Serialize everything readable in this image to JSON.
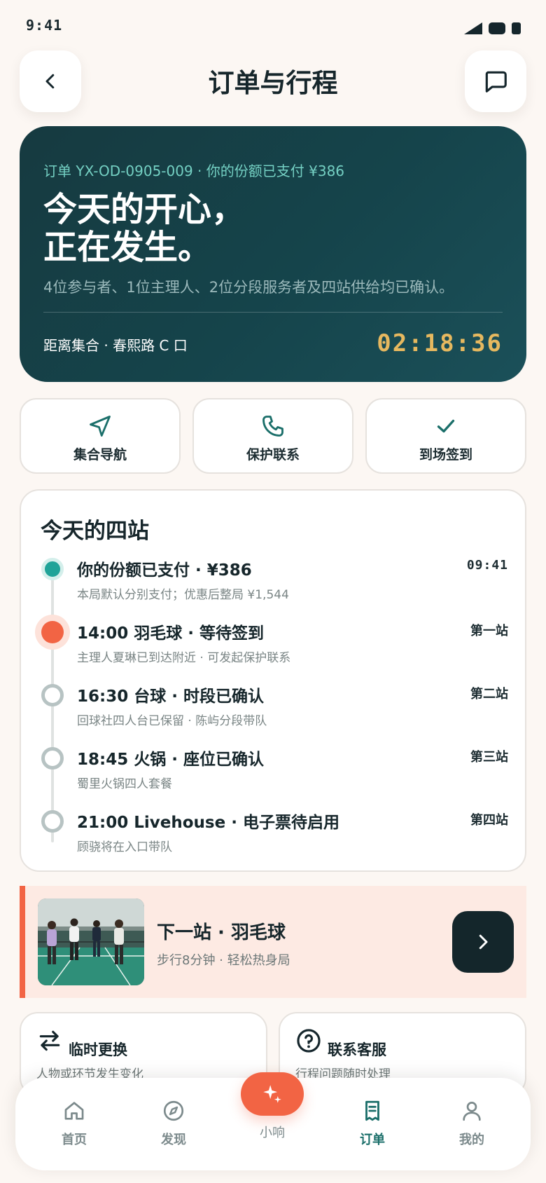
{
  "status_bar": {
    "time": "9:41"
  },
  "header": {
    "title": "订单与行程",
    "back_icon": "chevron-left-icon",
    "message_icon": "chat-icon"
  },
  "hero": {
    "order_line": "订单 YX-OD-0905-009 · 你的份额已支付 ¥386",
    "headline_1": "今天的开心，",
    "headline_2": "正在发生。",
    "subtitle": "4位参与者、1位主理人、2位分段服务者及四站供给均已确认。",
    "distance_label": "距离集合 · 春熙路 C 口",
    "countdown": "02:18:36",
    "countdown_color": "#e6b85f"
  },
  "actions": [
    {
      "label": "集合导航",
      "icon": "navigation-icon"
    },
    {
      "label": "保护联系",
      "icon": "phone-icon"
    },
    {
      "label": "到场签到",
      "icon": "check-icon"
    }
  ],
  "stations": {
    "title": "今天的四站",
    "items": [
      {
        "status": "done",
        "title": "你的份额已支付 · ¥386",
        "subtitle": "本局默认分别支付；优惠后整局 ¥1,544",
        "right": "09:41"
      },
      {
        "status": "active",
        "title": "14:00 羽毛球 · 等待签到",
        "subtitle": "主理人夏琳已到达附近 · 可发起保护联系",
        "right": "第一站"
      },
      {
        "status": "pending",
        "title": "16:30 台球 · 时段已确认",
        "subtitle": "回球社四人台已保留 · 陈屿分段带队",
        "right": "第二站"
      },
      {
        "status": "pending",
        "title": "18:45 火锅 · 座位已确认",
        "subtitle": "蜀里火锅四人套餐",
        "right": "第三站"
      },
      {
        "status": "pending",
        "title": "21:00 Livehouse · 电子票待启用",
        "subtitle": "顾骁将在入口带队",
        "right": "第四站"
      }
    ]
  },
  "next_stop": {
    "title": "下一站 · 羽毛球",
    "subtitle": "步行8分钟 · 轻松热身局",
    "accent": "#f26444"
  },
  "quick_actions": [
    {
      "title": "临时更换",
      "subtitle": "人物或环节发生变化",
      "icon": "swap-icon"
    },
    {
      "title": "联系客服",
      "subtitle": "行程问题随时处理",
      "icon": "help-circle-icon"
    }
  ],
  "tabbar": {
    "items": [
      {
        "label": "首页",
        "icon": "home-icon"
      },
      {
        "label": "发现",
        "icon": "compass-icon"
      },
      {
        "label": "小响",
        "icon": "sparkle-icon"
      },
      {
        "label": "订单",
        "icon": "receipt-icon",
        "selected": true
      },
      {
        "label": "我的",
        "icon": "user-icon"
      }
    ]
  },
  "colors": {
    "accent": "#f26444",
    "primary_dark": "#15444b",
    "teal": "#1fa398"
  }
}
